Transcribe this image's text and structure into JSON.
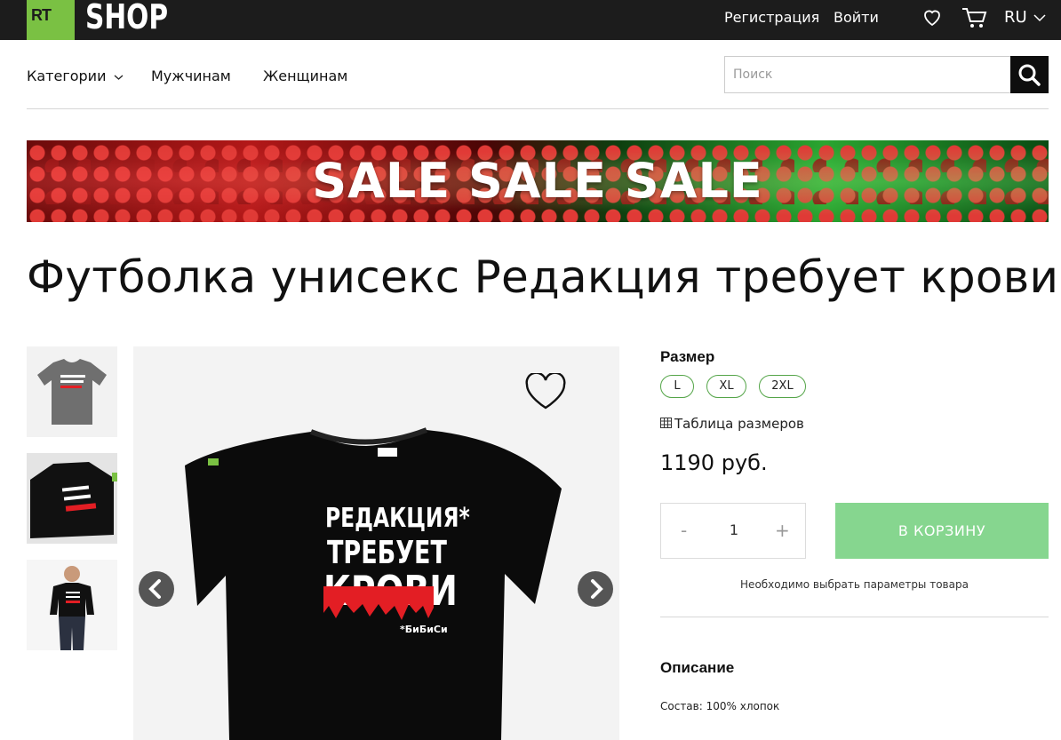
{
  "header": {
    "logo_rt": "RT",
    "logo_shop": "SHOP",
    "register_label": "Регистрация",
    "login_label": "Войти",
    "language": "RU"
  },
  "nav": {
    "categories_label": "Категории",
    "men_label": "Мужчинам",
    "women_label": "Женщинам",
    "search_placeholder": "Поиск"
  },
  "banner": {
    "text": "SALE SALE SALE"
  },
  "product": {
    "title": "Футболка унисекс Редакция требует крови",
    "shirt_text": [
      "РЕДАКЦИЯ*",
      "ТРЕБУЕТ",
      "КРОВИ",
      "*БиБиСи"
    ],
    "size_label": "Размер",
    "sizes": [
      "L",
      "XL",
      "2XL"
    ],
    "size_table_label": "Таблица размеров",
    "price": "1190 руб.",
    "quantity": "1",
    "qty_minus": "-",
    "qty_plus": "+",
    "cart_button": "В КОРЗИНУ",
    "note": "Необходимо выбрать параметры товара",
    "description_label": "Описание",
    "composition": "Состав: 100% хлопок"
  },
  "colors": {
    "topbar": "#1c1c1c",
    "logo_green": "#7ac143",
    "size_border": "#54a548",
    "cart_button": "#86d68f",
    "shirt_red": "#e31e24"
  }
}
